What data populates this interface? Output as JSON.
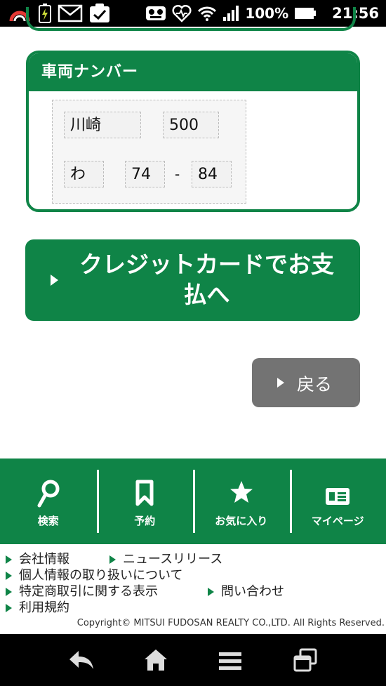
{
  "status_bar": {
    "battery_percent": "100%",
    "time": "21:56",
    "icons": [
      "sync-icon",
      "battery-charging-icon",
      "gmail-icon",
      "tasks-icon",
      "signal-app-icon",
      "heart-monitor-icon",
      "wifi-icon",
      "cell-signal-icon",
      "battery-icon"
    ]
  },
  "plate_card": {
    "title": "車両ナンバー",
    "region": "川崎",
    "class_number": "500",
    "hiragana": "わ",
    "number_first": "74",
    "separator": "-",
    "number_last": "84"
  },
  "pay_button": {
    "label": "クレジットカードでお支払へ"
  },
  "back_button": {
    "label": "戻る"
  },
  "bottom_nav": {
    "items": [
      {
        "label": "検索",
        "icon": "search-icon"
      },
      {
        "label": "予約",
        "icon": "bookmark-icon"
      },
      {
        "label": "お気に入り",
        "icon": "star-icon"
      },
      {
        "label": "マイページ",
        "icon": "id-card-icon"
      }
    ]
  },
  "footer": {
    "links": [
      "会社情報",
      "ニュースリリース",
      "個人情報の取り扱いについて",
      "特定商取引に関する表示",
      "問い合わせ",
      "利用規約"
    ],
    "copyright": "Copyright© MITSUI FUDOSAN REALTY CO.,LTD. All Rights Reserved."
  },
  "colors": {
    "brand_green": "#0f8447",
    "back_gray": "#737373"
  }
}
